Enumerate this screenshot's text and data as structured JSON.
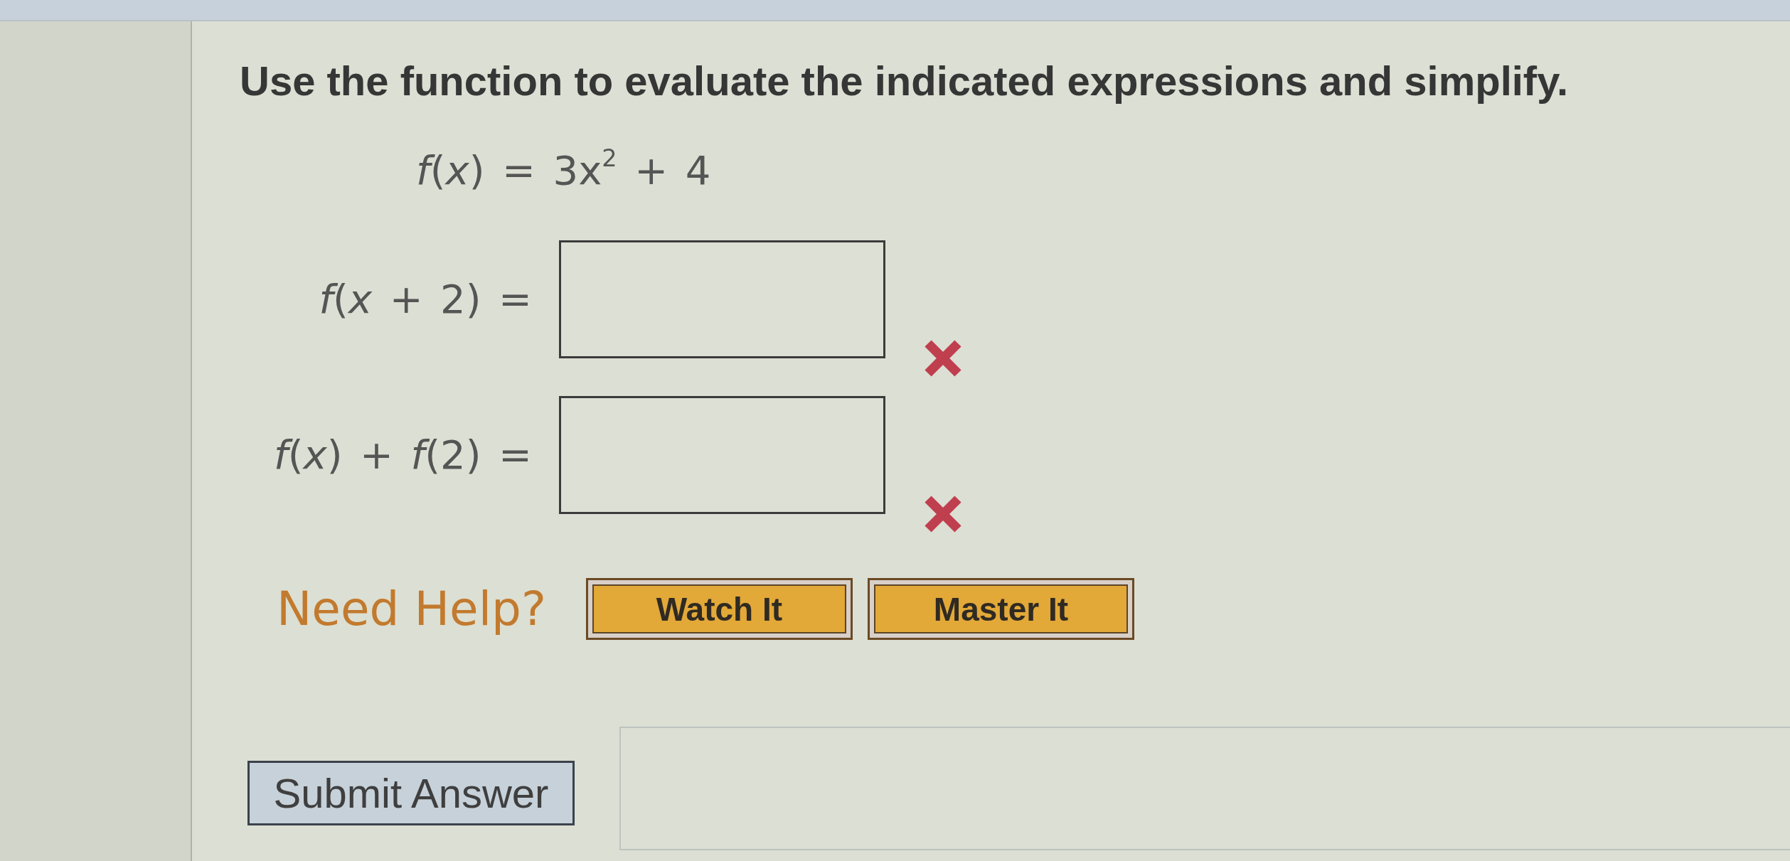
{
  "instruction": "Use the function to evaluate the indicated expressions and simplify.",
  "function": "*f*(*x*) = 3x$^{2}$ + 4",
  "answers": [
    {
      "label": "*f*(*x* + 2) =",
      "correct": false
    },
    {
      "label": "*f*(*x*) + *f*(2) =",
      "correct": false
    }
  ],
  "help": {
    "label": "Need Help?",
    "buttons": [
      "Watch It",
      "Master It"
    ]
  },
  "submit": "Submit Answer"
}
